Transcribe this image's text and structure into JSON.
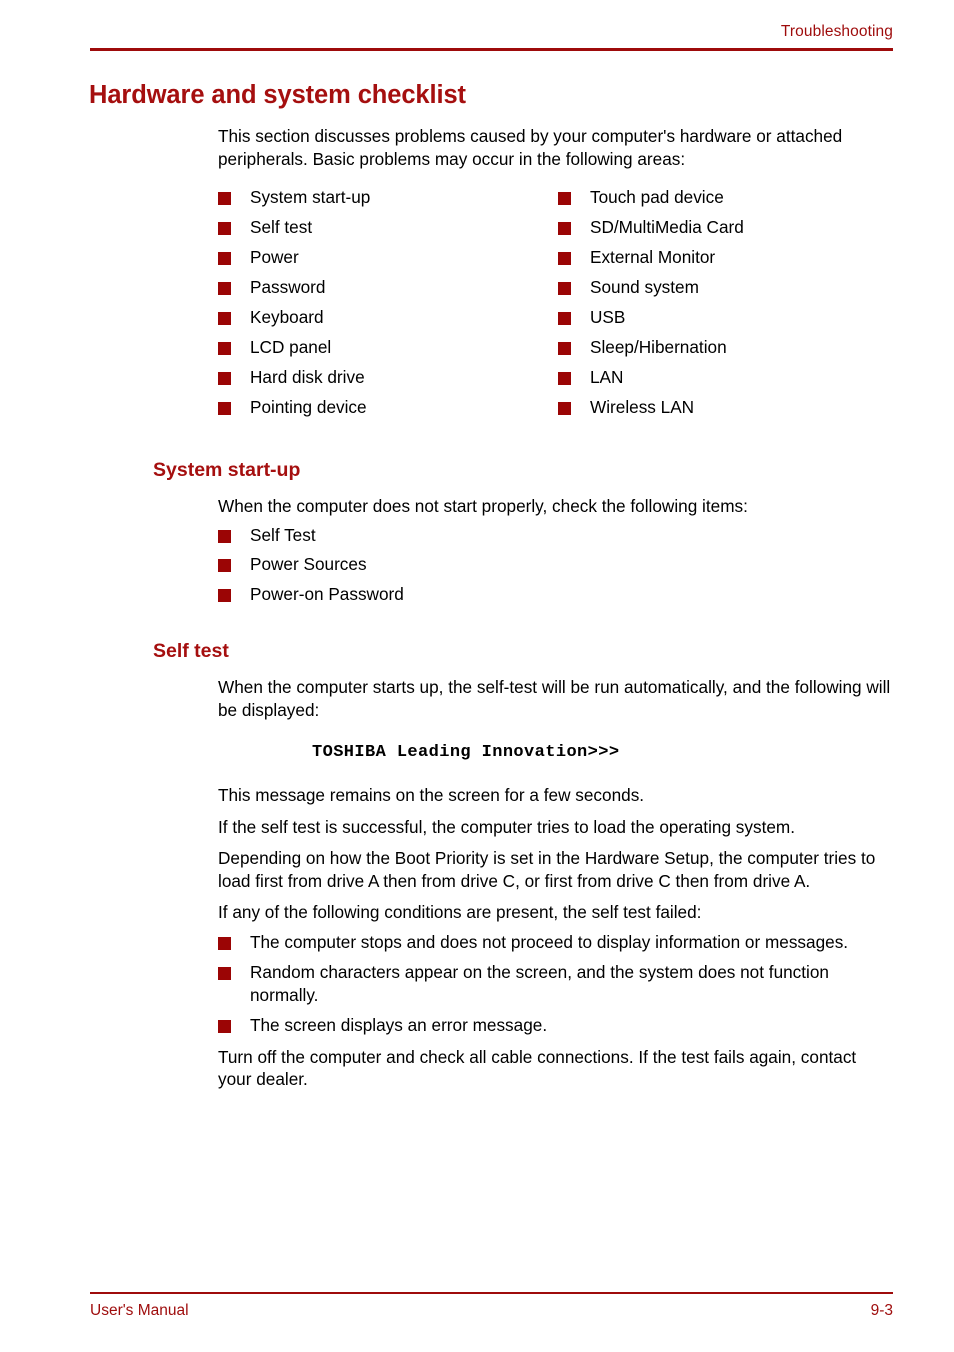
{
  "header": {
    "running_head": "Troubleshooting",
    "rule_color": "#9e0b0b"
  },
  "title": "Hardware and system checklist",
  "intro": "This section discusses problems caused by your computer's hardware or attached peripherals. Basic problems may occur in the following areas:",
  "checklist": {
    "left_column": [
      "System start-up",
      "Self test",
      "Power",
      "Password",
      "Keyboard",
      "LCD panel",
      "Hard disk drive",
      "Pointing device"
    ],
    "right_column": [
      "Touch pad device",
      "SD/MultiMedia Card",
      "External Monitor",
      "Sound system",
      "USB",
      "Sleep/Hibernation",
      "LAN",
      "Wireless LAN"
    ]
  },
  "sections": [
    {
      "heading": "System start-up",
      "intro": "When the computer does not start properly, check the following items:",
      "items": [
        "Self Test",
        "Power Sources",
        "Power-on Password"
      ]
    },
    {
      "heading": "Self test",
      "intro": "When the computer starts up, the self-test will be run automatically, and the following will be displayed:",
      "code_line": "TOSHIBA Leading Innovation>>>",
      "paragraphs": [
        "This message remains on the screen for a few seconds.",
        "If the self test is successful, the computer tries to load the operating system.",
        "Depending on how the Boot Priority is set in the Hardware Setup, the computer tries to load first from drive A then from drive C, or first from drive C then from drive A.",
        "If any of the following conditions are present, the self test failed:"
      ],
      "failure_items": [
        "The computer stops and does not proceed to display information or messages.",
        "Random characters appear on the screen, and the system does not function normally.",
        "The screen displays an error message."
      ],
      "closing": "Turn off the computer and check all cable connections. If the test fails again, contact your dealer."
    }
  ],
  "footer": {
    "left": "User's Manual",
    "page_number": "9-3"
  },
  "colors": {
    "heading_red": "#a50f0f",
    "rule_red": "#9e0b0b",
    "bullet_red": "#9b0505",
    "body_black": "#000000"
  }
}
